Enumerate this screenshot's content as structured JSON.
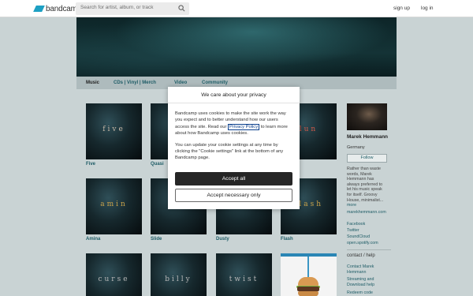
{
  "header": {
    "logo_text": "bandcamp",
    "search_placeholder": "Search for artist, album, or track",
    "signup_label": "sign up",
    "login_label": "log in"
  },
  "tabs": [
    {
      "label": "Music"
    },
    {
      "label": "CDs | Vinyl | Merch"
    },
    {
      "label": "Video"
    },
    {
      "label": "Community"
    }
  ],
  "albums": [
    {
      "title": "Five",
      "cover_word": "five",
      "cover_word_color": "#c9b9a8"
    },
    {
      "title": "Quasi",
      "cover_word": "q",
      "cover_word_color": "#c9a24a"
    },
    {
      "title": "",
      "cover_word": "",
      "cover_word_color": "#ffffff"
    },
    {
      "title": "",
      "cover_word": "lun",
      "cover_word_color": "#d05a4a"
    },
    {
      "title": "Amina",
      "cover_word": "amin",
      "cover_word_color": "#c9a24a"
    },
    {
      "title": "Slide",
      "cover_word": "s",
      "cover_word_color": "#c9a24a"
    },
    {
      "title": "Dusty",
      "cover_word": "",
      "cover_word_color": "#ffffff"
    },
    {
      "title": "Flash",
      "cover_word": "flash",
      "cover_word_color": "#c9a24a"
    },
    {
      "title": "",
      "cover_word": "curse",
      "cover_word_color": "#b8b8b8"
    },
    {
      "title": "",
      "cover_word": "billy",
      "cover_word_color": "#b8b8b8"
    },
    {
      "title": "",
      "cover_word": "twist",
      "cover_word_color": "#b8b8b8"
    }
  ],
  "artist": {
    "name": "Marek Hemmann",
    "location": "Germany",
    "follow_label": "Follow",
    "bio": "Rather than waste words, Marek Hemmann has always preferred to let his music speak for itself. Groovy House, minimalist...",
    "bio_more": "more",
    "links": [
      "marekhemmann.com",
      "Facebook",
      "Twitter",
      "SoundCloud",
      "open.spotify.com"
    ],
    "contact_heading": "contact / help",
    "contact_links": [
      "Contact Marek Hemmann",
      "Streaming and Download help",
      "Redeem code"
    ]
  },
  "cookie_modal": {
    "title": "We care about your privacy",
    "body_before_link": "Bandcamp uses cookies to make the site work the way you expect and to better understand how our users access the site. Read our ",
    "privacy_link": "Privacy Policy",
    "body_after_link": " to learn more about how Bandcamp uses cookies.",
    "body_2": "You can update your cookie settings at any time by clicking the \"Cookie settings\" link at the bottom of any Bandcamp page.",
    "accept_all_label": "Accept all",
    "accept_necessary_label": "Accept necessary only"
  },
  "colors": {
    "accent_link": "#1e5c66",
    "logo_blue": "#1da0c3",
    "page_bg": "#c9d3d4"
  }
}
